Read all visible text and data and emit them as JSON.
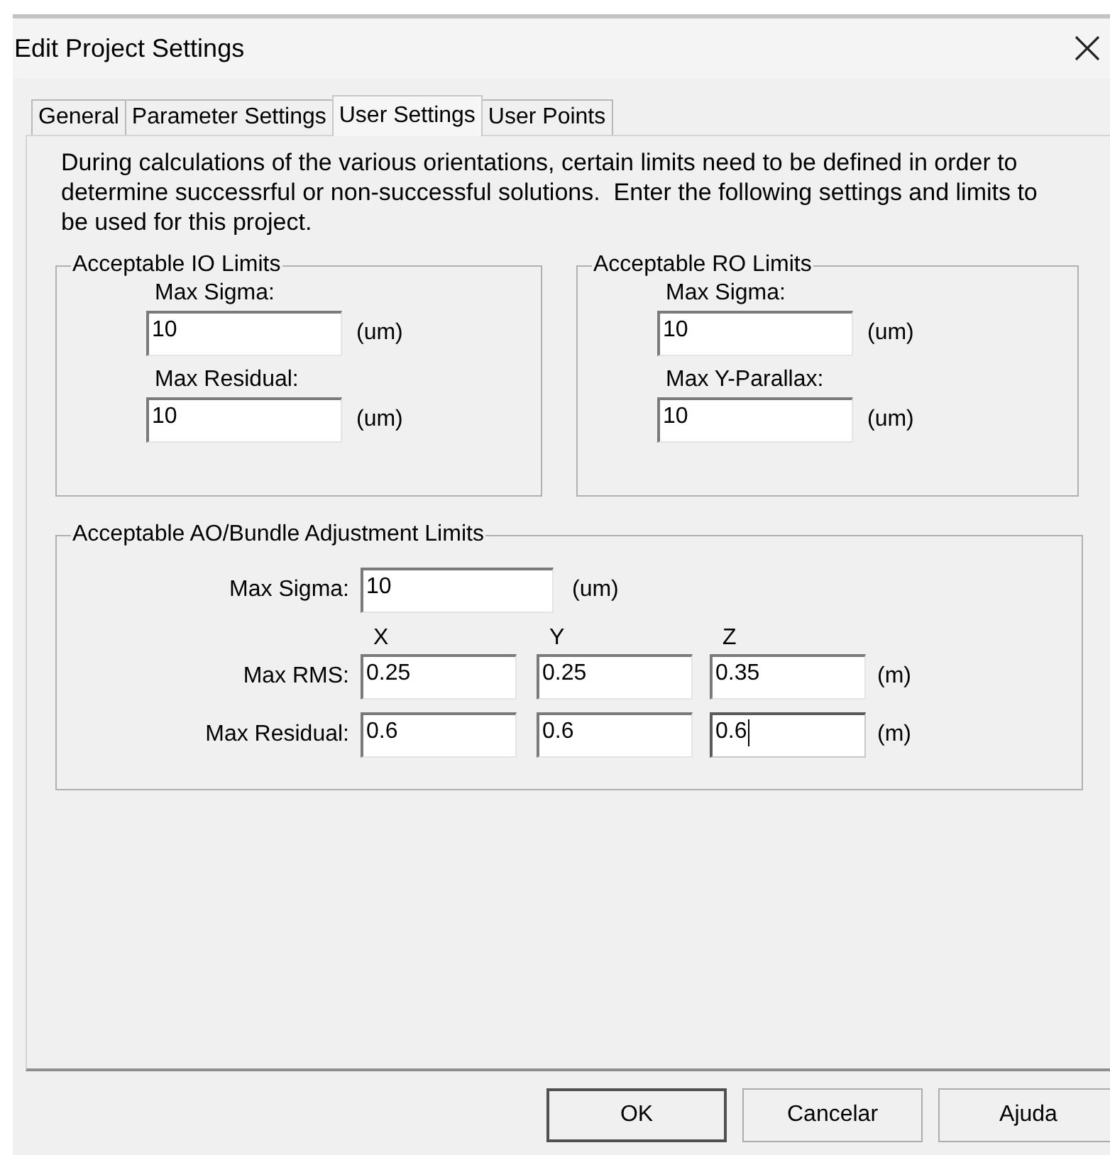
{
  "window": {
    "title": "Edit Project Settings"
  },
  "tabs": [
    {
      "label": "General",
      "selected": false
    },
    {
      "label": "Parameter Settings",
      "selected": false
    },
    {
      "label": "User Settings",
      "selected": true
    },
    {
      "label": "User Points",
      "selected": false
    }
  ],
  "description": "During calculations of the various orientations, certain limits need to be defined in order to determine successrful or non-successful solutions.  Enter the following settings and limits to be used for this project.",
  "io_limits": {
    "title": "Acceptable IO Limits",
    "fields": [
      {
        "label": "Max Sigma:",
        "value": "10",
        "unit": "(um)",
        "focused": false
      },
      {
        "label": "Max Residual:",
        "value": "10",
        "unit": "(um)",
        "focused": false
      }
    ]
  },
  "ro_limits": {
    "title": "Acceptable RO Limits",
    "fields": [
      {
        "label": "Max Sigma:",
        "value": "10",
        "unit": "(um)",
        "focused": false
      },
      {
        "label": "Max Y-Parallax:",
        "value": "10",
        "unit": "(um)",
        "focused": false
      }
    ]
  },
  "ao_limits": {
    "title": "Acceptable AO/Bundle Adjustment Limits",
    "sigma": {
      "label": "Max Sigma:",
      "value": "10",
      "unit": "(um)",
      "focused": false
    },
    "axes": [
      "X",
      "Y",
      "Z"
    ],
    "rows": [
      {
        "label": "Max RMS:",
        "unit": "(m)",
        "values": [
          {
            "value": "0.25",
            "focused": false
          },
          {
            "value": "0.25",
            "focused": false
          },
          {
            "value": "0.35",
            "focused": false
          }
        ]
      },
      {
        "label": "Max Residual:",
        "unit": "(m)",
        "values": [
          {
            "value": "0.6",
            "focused": false
          },
          {
            "value": "0.6",
            "focused": false
          },
          {
            "value": "0.6",
            "focused": true
          }
        ]
      }
    ]
  },
  "buttons": [
    {
      "label": "OK",
      "default": true
    },
    {
      "label": "Cancelar",
      "default": false
    },
    {
      "label": "Ajuda",
      "default": false
    }
  ]
}
